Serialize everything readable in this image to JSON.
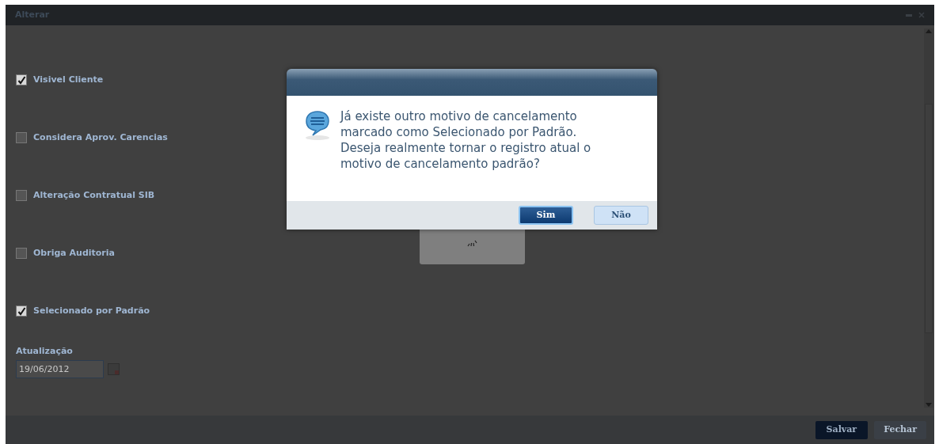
{
  "window": {
    "title": "Alterar"
  },
  "checkboxes": [
    {
      "label": "Visivel Cliente",
      "checked": true
    },
    {
      "label": "Considera Aprov. Carencias",
      "checked": false
    },
    {
      "label": "Alteração Contratual SIB",
      "checked": false
    },
    {
      "label": "Obriga Auditoria",
      "checked": false
    },
    {
      "label": "Selecionado por Padrão",
      "checked": true
    }
  ],
  "date_field": {
    "label": "Atualização",
    "value": "19/06/2012"
  },
  "footer_buttons": [
    {
      "label": "Salvar",
      "kind": "primary"
    },
    {
      "label": "Fechar",
      "kind": "secondary"
    }
  ],
  "dialog": {
    "message": "Já existe outro motivo de cancelamento marcado como Selecionado por Padrão. Deseja realmente tornar o registro atual o motivo de cancelamento padrão?",
    "buttons": [
      {
        "label": "Sim",
        "kind": "primary"
      },
      {
        "label": "Não",
        "kind": "secondary"
      }
    ]
  }
}
